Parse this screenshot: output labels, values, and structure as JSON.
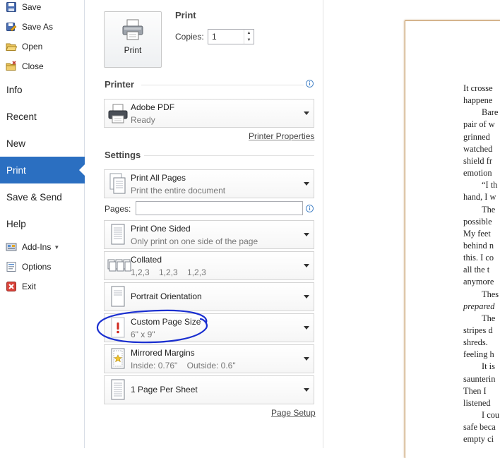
{
  "nav": {
    "save": "Save",
    "save_as": "Save As",
    "open": "Open",
    "close": "Close",
    "info": "Info",
    "recent": "Recent",
    "new": "New",
    "print": "Print",
    "save_send": "Save & Send",
    "help": "Help",
    "add_ins": "Add-Ins",
    "options": "Options",
    "exit": "Exit"
  },
  "print": {
    "button_label": "Print",
    "heading": "Print",
    "copies_label": "Copies:",
    "copies_value": "1"
  },
  "printer": {
    "heading": "Printer",
    "name": "Adobe PDF",
    "status": "Ready",
    "properties_link": "Printer Properties"
  },
  "settings": {
    "heading": "Settings",
    "pages_label": "Pages:",
    "pages_value": "",
    "page_setup_link": "Page Setup",
    "items": [
      {
        "title": "Print All Pages",
        "subtitle": "Print the entire document"
      },
      {
        "title": "Print One Sided",
        "subtitle": "Only print on one side of the page"
      },
      {
        "title": "Collated",
        "subtitle": "1,2,3    1,2,3    1,2,3"
      },
      {
        "title": "Portrait Orientation",
        "subtitle": ""
      },
      {
        "title": "Custom Page Size",
        "subtitle": "6\" x 9\""
      },
      {
        "title": "Mirrored Margins",
        "subtitle": "Inside: 0.76\"    Outside: 0.6\""
      },
      {
        "title": "1 Page Per Sheet",
        "subtitle": ""
      }
    ]
  },
  "preview": {
    "lines": [
      {
        "text": "It crosse",
        "italic": false,
        "indent": false
      },
      {
        "text": "happene",
        "italic": false,
        "indent": false
      },
      {
        "text": "Bare",
        "italic": false,
        "indent": true
      },
      {
        "text": "pair of w",
        "italic": false,
        "indent": false
      },
      {
        "text": "grinned",
        "italic": false,
        "indent": false
      },
      {
        "text": "watched",
        "italic": false,
        "indent": false
      },
      {
        "text": "shield fr",
        "italic": false,
        "indent": false
      },
      {
        "text": "emotion",
        "italic": false,
        "indent": false
      },
      {
        "text": "“I th",
        "italic": false,
        "indent": true
      },
      {
        "text": "hand, I w",
        "italic": false,
        "indent": false
      },
      {
        "text": "The",
        "italic": false,
        "indent": true
      },
      {
        "text": "possible",
        "italic": false,
        "indent": false
      },
      {
        "text": "My feet",
        "italic": false,
        "indent": false
      },
      {
        "text": "behind n",
        "italic": false,
        "indent": false
      },
      {
        "text": "this. I co",
        "italic": false,
        "indent": false
      },
      {
        "text": "all the t",
        "italic": false,
        "indent": false
      },
      {
        "text": "anymore",
        "italic": false,
        "indent": false
      },
      {
        "text": "Thes",
        "italic": false,
        "indent": true
      },
      {
        "text": "prepared",
        "italic": true,
        "indent": false
      },
      {
        "text": "The",
        "italic": false,
        "indent": true
      },
      {
        "text": "stripes d",
        "italic": false,
        "indent": false
      },
      {
        "text": "shreds.",
        "italic": false,
        "indent": false
      },
      {
        "text": "feeling h",
        "italic": false,
        "indent": false
      },
      {
        "text": "It is",
        "italic": false,
        "indent": true
      },
      {
        "text": "saunterin",
        "italic": false,
        "indent": false
      },
      {
        "text": "Then I",
        "italic": false,
        "indent": false
      },
      {
        "text": "listened",
        "italic": false,
        "indent": false
      },
      {
        "text": "I cou",
        "italic": false,
        "indent": true
      },
      {
        "text": "safe beca",
        "italic": false,
        "indent": false
      },
      {
        "text": "empty ci",
        "italic": false,
        "indent": false
      }
    ]
  },
  "colors": {
    "nav_active": "#2b6fc1",
    "annotation_ink": "#1a2fd0",
    "page_border": "#c79a62"
  }
}
